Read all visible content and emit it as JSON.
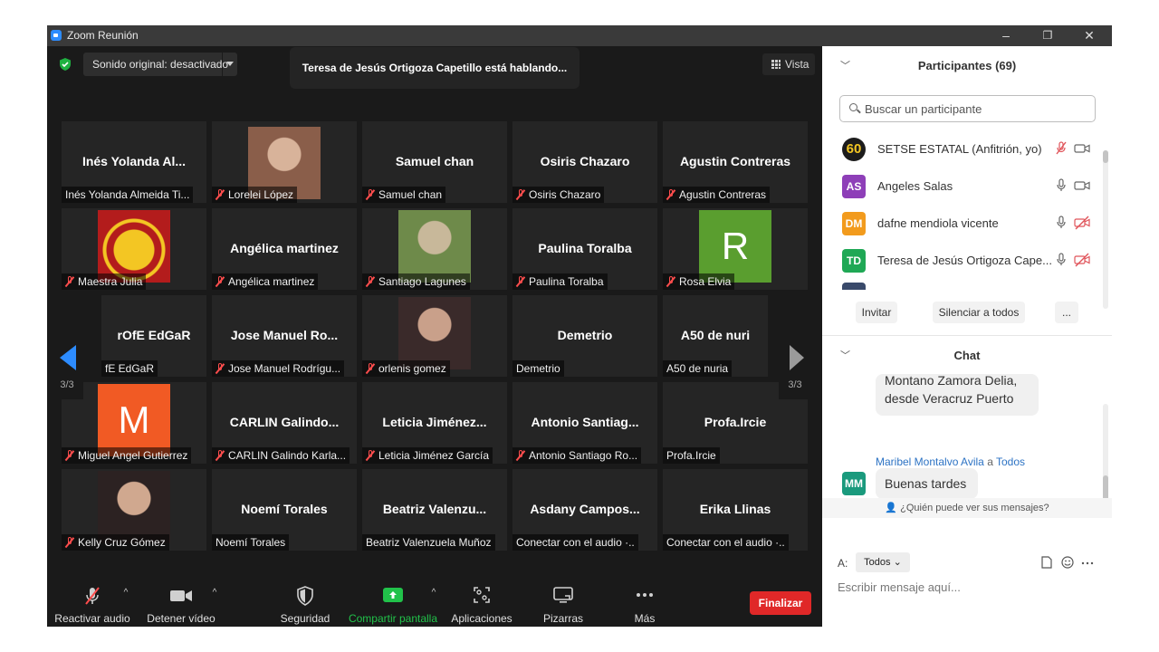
{
  "window": {
    "title": "Zoom Reunión",
    "minimize": "–",
    "restore": "❐",
    "close": "✕"
  },
  "stage": {
    "sound_button": "Sonido original: desactivado",
    "speaking": "Teresa de Jesús Ortigoza Capetillo está hablando...",
    "view_button": "Vista",
    "page_left": "3/3",
    "page_right": "3/3"
  },
  "tiles": [
    {
      "name": "Inés Yolanda Al...",
      "label": "Inés Yolanda Almeida Ti...",
      "muted": false,
      "avatar": "none"
    },
    {
      "name": "",
      "label": "Lorelei López",
      "muted": true,
      "avatar": "photo"
    },
    {
      "name": "Samuel chan",
      "label": "Samuel chan",
      "muted": true,
      "avatar": "none"
    },
    {
      "name": "Osiris Chazaro",
      "label": "Osiris Chazaro",
      "muted": true,
      "avatar": "none"
    },
    {
      "name": "Agustin Contreras",
      "label": "Agustin Contreras",
      "muted": true,
      "avatar": "none"
    },
    {
      "name": "",
      "label": "Maestra Julia",
      "muted": true,
      "avatar": "logo"
    },
    {
      "name": "Angélica martinez",
      "label": "Angélica martinez",
      "muted": true,
      "avatar": "none"
    },
    {
      "name": "",
      "label": "Santiago Lagunes",
      "muted": true,
      "avatar": "photo"
    },
    {
      "name": "Paulina Toralba",
      "label": "Paulina Toralba",
      "muted": true,
      "avatar": "none"
    },
    {
      "name": "",
      "label": "Rosa Elvia",
      "muted": true,
      "avatar": "letter",
      "letter": "R",
      "color": "#5a9e2f"
    },
    {
      "name": "rOfE EdGaR",
      "label": "fE EdGaR",
      "muted": false,
      "avatar": "none"
    },
    {
      "name": "Jose Manuel Ro...",
      "label": "Jose Manuel Rodrígu...",
      "muted": true,
      "avatar": "none"
    },
    {
      "name": "",
      "label": "orlenis gomez",
      "muted": true,
      "avatar": "photo"
    },
    {
      "name": "Demetrio",
      "label": "Demetrio",
      "muted": false,
      "avatar": "none"
    },
    {
      "name": "A50 de nuri",
      "label": "A50 de nuria",
      "muted": false,
      "avatar": "none"
    },
    {
      "name": "",
      "label": "Miguel Angel Gutierrez",
      "muted": true,
      "avatar": "letter",
      "letter": "M",
      "color": "#f15a24"
    },
    {
      "name": "CARLIN Galindo...",
      "label": "CARLIN Galindo Karla...",
      "muted": true,
      "avatar": "none"
    },
    {
      "name": "Leticia Jiménez...",
      "label": "Leticia Jiménez García",
      "muted": true,
      "avatar": "none"
    },
    {
      "name": "Antonio Santiag...",
      "label": "Antonio Santiago Ro...",
      "muted": true,
      "avatar": "none"
    },
    {
      "name": "Profa.Ircie",
      "label": "Profa.Ircie",
      "muted": false,
      "avatar": "none"
    },
    {
      "name": "",
      "label": "Kelly Cruz Gómez",
      "muted": true,
      "avatar": "photo"
    },
    {
      "name": "Noemí Torales",
      "label": "Noemí Torales",
      "muted": false,
      "avatar": "none"
    },
    {
      "name": "Beatriz Valenzu...",
      "label": "Beatriz Valenzuela Muñoz",
      "muted": false,
      "avatar": "none"
    },
    {
      "name": "Asdany Campos...",
      "label": "Conectar con el audio ·..",
      "muted": false,
      "avatar": "none"
    },
    {
      "name": "Erika Llinas",
      "label": "Conectar con el audio ·..",
      "muted": false,
      "avatar": "none"
    }
  ],
  "toolbar": {
    "unmute": "Reactivar audio",
    "stop_video": "Detener vídeo",
    "security": "Seguridad",
    "share": "Compartir pantalla",
    "apps": "Aplicaciones",
    "whiteboards": "Pizarras",
    "more": "Más",
    "end": "Finalizar",
    "caret": "^"
  },
  "participants": {
    "header": "Participantes (69)",
    "search_placeholder": "Buscar un participante",
    "list": [
      {
        "initials": "60",
        "name": "SETSE ESTATAL (Anfitrión, yo)",
        "color": "#1c1c1c",
        "mic": "muted",
        "video": "on"
      },
      {
        "initials": "AS",
        "name": "Angeles Salas",
        "color": "#8e3fb8",
        "mic": "on",
        "video": "on"
      },
      {
        "initials": "DM",
        "name": "dafne mendiola vicente",
        "color": "#f29b1d",
        "mic": "on",
        "video": "off"
      },
      {
        "initials": "TD",
        "name": "Teresa de Jesús Ortigoza Cape...",
        "color": "#1fa855",
        "mic": "on",
        "video": "off"
      }
    ],
    "invite": "Invitar",
    "mute_all": "Silenciar a todos",
    "more": "..."
  },
  "chat": {
    "header": "Chat",
    "prev_message_line1": "Montano Zamora Delia,",
    "prev_message_line2": "desde Veracruz Puerto",
    "sender": "Maribel Montalvo Avila",
    "to_word": "a",
    "recipient": "Todos",
    "sender_initials": "MM",
    "sender_color": "#1a9a7d",
    "message": "Buenas tardes",
    "who_can_see": "¿Quién puede ver sus mensajes?",
    "to_label": "A:",
    "to_value": "Todos",
    "input_placeholder": "Escribir mensaje aquí..."
  },
  "colors": {
    "accent": "#2d8cff",
    "end": "#e02828",
    "share": "#21c24a",
    "muted": "#ff4d4d"
  }
}
